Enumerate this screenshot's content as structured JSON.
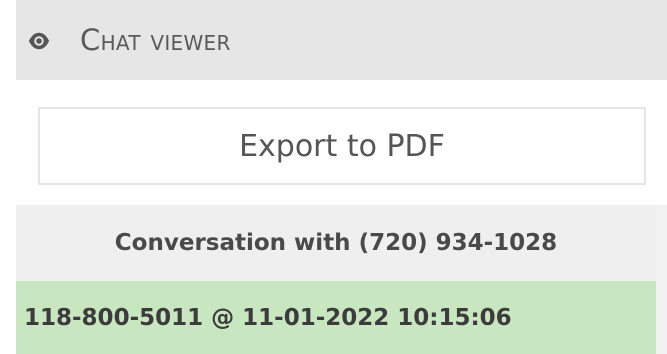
{
  "header": {
    "title_initial": "C",
    "title_rest": "hat viewer",
    "icon": "eye-icon"
  },
  "toolbar": {
    "export_label": "Export to PDF"
  },
  "conversation": {
    "title": "Conversation with (720) 934-1028",
    "messages": [
      {
        "meta": "118-800-5011 @ 11-01-2022 10:15:06",
        "highlight_color": "#c8e6c0"
      }
    ]
  },
  "colors": {
    "header_bg": "#e6e6e6",
    "conversation_header_bg": "#efefef",
    "message_bg": "#c8e6c0"
  }
}
